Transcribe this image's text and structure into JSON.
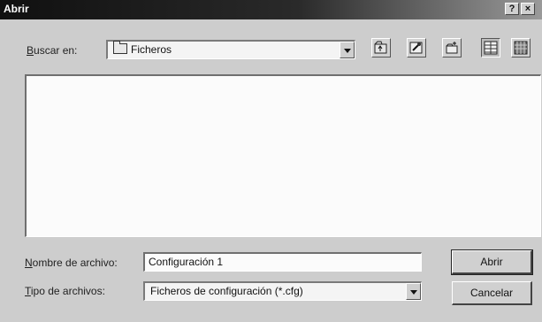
{
  "window": {
    "title": "Abrir",
    "help_button": "?",
    "close_button": "×"
  },
  "look_in": {
    "label_access": "B",
    "label_rest": "uscar en:",
    "value": "Ficheros"
  },
  "toolbar": {
    "icons": [
      "up-folder-icon",
      "desktop-icon",
      "new-folder-icon",
      "list-view-icon",
      "details-view-icon"
    ]
  },
  "filename": {
    "label_access": "N",
    "label_rest": "ombre de archivo:",
    "value": "Configuración 1"
  },
  "filetype": {
    "label_access": "T",
    "label_rest": "ipo de archivos:",
    "value": "Ficheros de configuración (*.cfg)"
  },
  "buttons": {
    "open": "Abrir",
    "cancel": "Cancelar"
  }
}
